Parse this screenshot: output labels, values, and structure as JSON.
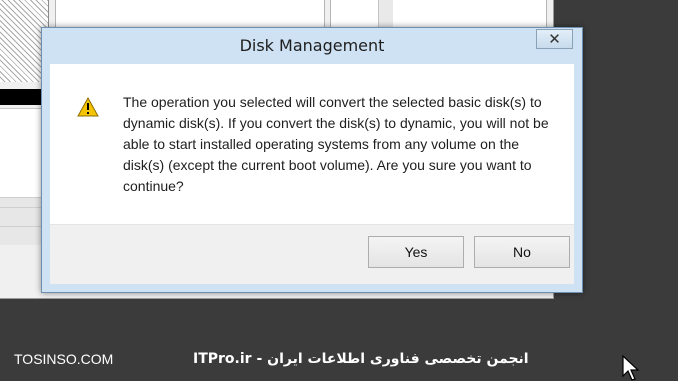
{
  "dialog": {
    "title": "Disk Management",
    "close_symbol": "✕",
    "icon": "warning-icon",
    "message": "The operation you selected will convert the selected basic disk(s) to dynamic disk(s). If you convert the disk(s) to dynamic, you will not be able to start installed operating systems from any volume on the disk(s) (except the current boot volume). Are you sure you want to continue?",
    "buttons": {
      "yes": "Yes",
      "no": "No"
    }
  },
  "watermark": {
    "left": "TOSINSO.COM",
    "center": "ITPro.ir - انجمن تخصصی فناوری اطلاعات ایران"
  },
  "colors": {
    "dialog_frame": "#cfe2f3",
    "desktop": "#3b3b3b",
    "warning_yellow": "#f5c400"
  }
}
